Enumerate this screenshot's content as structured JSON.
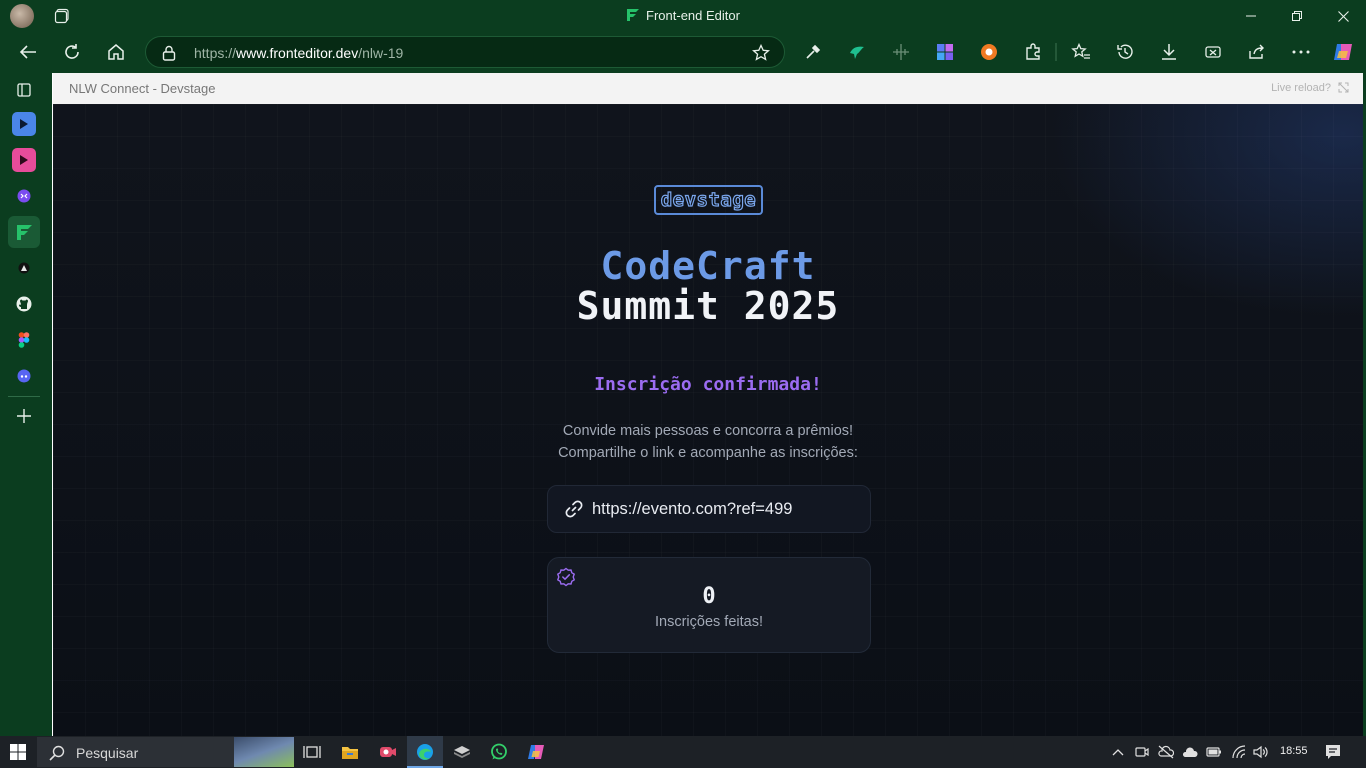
{
  "browser": {
    "window_title": "Front-end Editor",
    "url_scheme": "https://",
    "url_domain": "www.fronteditor.dev",
    "url_path": "/nlw-19"
  },
  "frame": {
    "title": "NLW Connect - Devstage",
    "live_reload": "Live reload?"
  },
  "page": {
    "logo": "devstage",
    "title_line1": "CodeCraft",
    "title_line2": "Summit 2025",
    "confirmed": "Inscrição confirmada!",
    "desc_line1": "Convide mais pessoas e concorra a prêmios!",
    "desc_line2": "Compartilhe o link e acompanhe as inscrições:",
    "invite_link": "https://evento.com?ref=499",
    "subscriptions_count": "0",
    "subscriptions_label": "Inscrições feitas!"
  },
  "taskbar": {
    "search_placeholder": "Pesquisar",
    "time": "18:55"
  },
  "colors": {
    "chrome_bg": "#0b3d1f",
    "title_blue": "#6c9ae6",
    "accent_purple": "#9b6cf1",
    "stage_bg": "#0b0f16"
  }
}
